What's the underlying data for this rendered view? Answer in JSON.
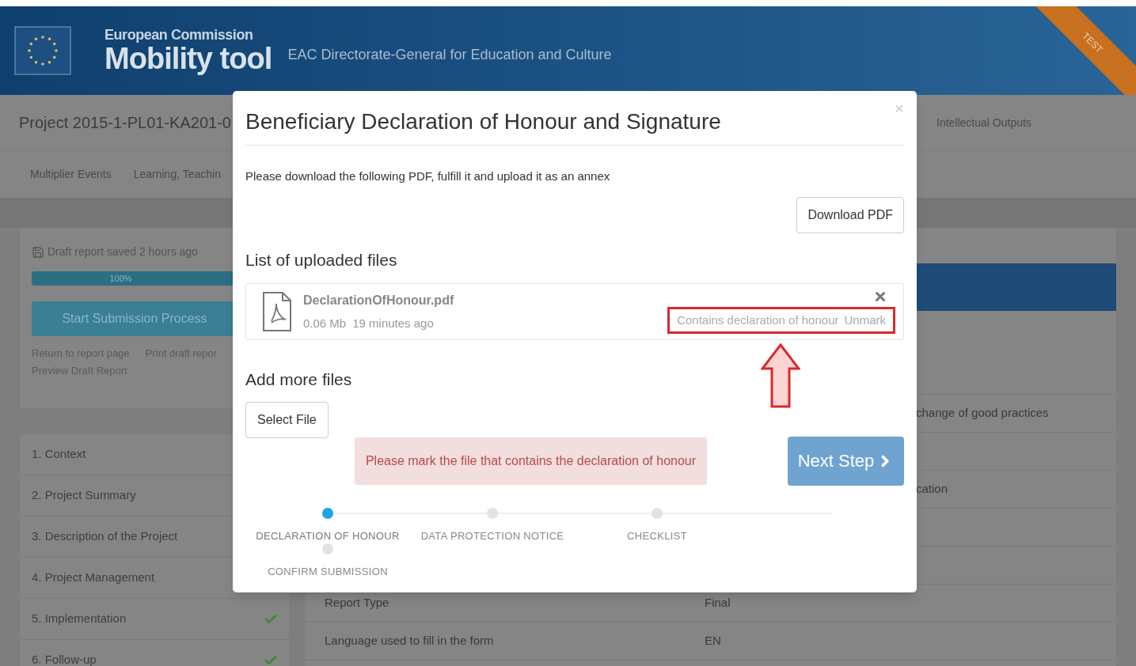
{
  "header": {
    "organization": "European Commission",
    "app_name": "Mobility tool",
    "subtitle": "EAC Directorate-General for Education and Culture",
    "ribbon": "TEST"
  },
  "project_title": "Project 2015-1-PL01-KA201-0",
  "tabs": [
    "Multiplier Events",
    "Learning, Teachin"
  ],
  "tabs_right": [
    "Intellectual Outputs"
  ],
  "report_panel": {
    "saved_note": "Draft report saved 2 hours ago",
    "progress": {
      "label": "100%",
      "level": 1
    },
    "submit_button": "Start Submission Process",
    "links": [
      "Return to report page",
      "Print draft repor"
    ],
    "preview_link": "Preview Draft Report"
  },
  "sections": [
    {
      "label": "1. Context"
    },
    {
      "label": "2. Project Summary"
    },
    {
      "label": "3. Description of the Project"
    },
    {
      "label": "4. Project Management"
    },
    {
      "label": "5. Implementation",
      "completed": true
    },
    {
      "label": "6. Follow-up",
      "completed": true
    }
  ],
  "summary_fragments": [
    "change of good practices",
    "cation"
  ],
  "details_rows": [
    {
      "label": "Report Type",
      "value": "Final"
    },
    {
      "label": "Language used to fill in the form",
      "value": "EN"
    }
  ],
  "dialog": {
    "title": "Beneficiary Declaration of Honour and Signature",
    "close": "×",
    "instruction": "Please download the following PDF, fulfill it and upload it as an annex",
    "download_button": "Download PDF",
    "uploaded_heading": "List of uploaded files",
    "files": [
      {
        "name": "DeclarationOfHonour.pdf",
        "size": "0.06 Mb",
        "uploaded": "19 minutes ago",
        "mark_status": "Contains declaration of honour",
        "mark_action": "Unmark",
        "highlighted": true
      }
    ],
    "add_heading": "Add more files",
    "select_button": "Select File",
    "alert": "Please mark the file that contains the declaration of honour",
    "next_button": "Next Step",
    "steps": [
      {
        "label": "DECLARATION OF HONOUR",
        "selected": true
      },
      {
        "label": "DATA PROTECTION NOTICE",
        "selected": false
      },
      {
        "label": "CHECKLIST",
        "selected": false
      },
      {
        "label": "CONFIRM SUBMISSION",
        "selected": false
      }
    ]
  }
}
